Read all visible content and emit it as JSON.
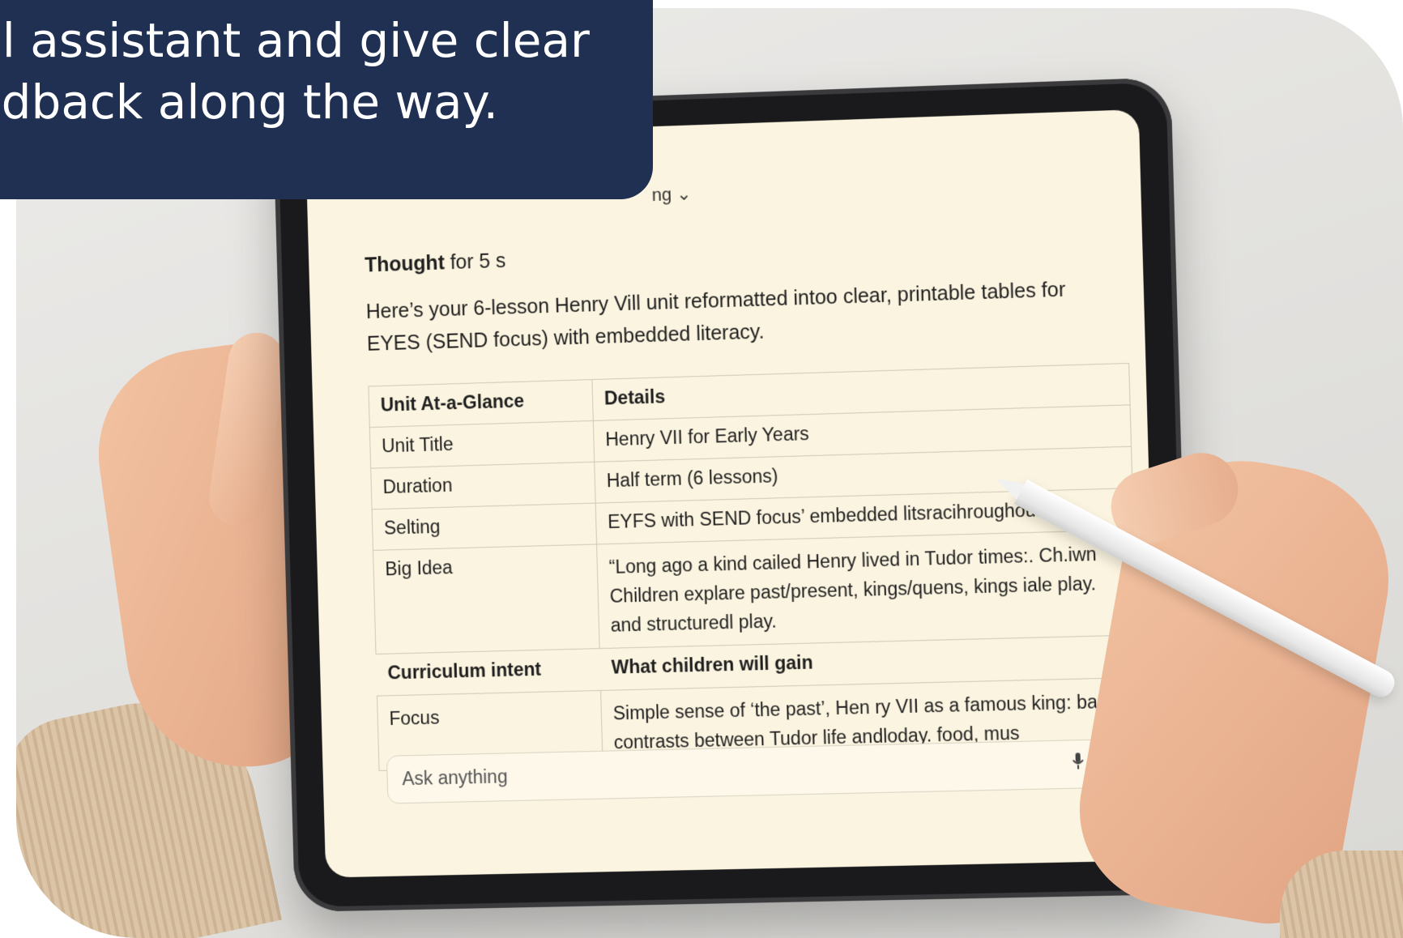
{
  "caption": {
    "line1": "ul assistant and give clear",
    "line2": "edback along the way."
  },
  "screen": {
    "model_label": "ng ⌄",
    "thought_prefix": "Thought",
    "thought_suffix": " for 5 s",
    "intro": "Here’s your 6-lesson Henry Vill unit reformatted intoo clear, printable tables for EYES (SEND focus) with embedded literacy.",
    "glance_table": {
      "headers": [
        "Unit At-a-Glance",
        "Details"
      ],
      "rows": [
        {
          "key": "Unit Title",
          "value": "Henry VII for Early Years"
        },
        {
          "key": "Duration",
          "value": "Half term (6 lessons)"
        },
        {
          "key": "Selting",
          "value": "EYFS with SEND focus’ embedded litsracihroughout"
        },
        {
          "key": "Big Idea",
          "value": "“Long ago  a kind cailed Henry lived in Tudor times:. Ch.iwn Children explare past/present, kings/quens, kings iale play. and structuredl play."
        }
      ]
    },
    "intent_table": {
      "headers": [
        "Curriculum intent",
        "What children will gain"
      ],
      "rows": [
        {
          "key": "Focus",
          "value": "Simple sense of ‘the past’, Hen ry VII as a famous king: basic contrasts between Tudor life andloday. food, mus"
        }
      ]
    },
    "ask_placeholder": "Ask anything",
    "mic_icon": "microphone-icon"
  },
  "colors": {
    "caption_bg": "#1f3052",
    "screen_bg": "#fbf4e0",
    "tablet_frame": "#1a1a1c"
  }
}
